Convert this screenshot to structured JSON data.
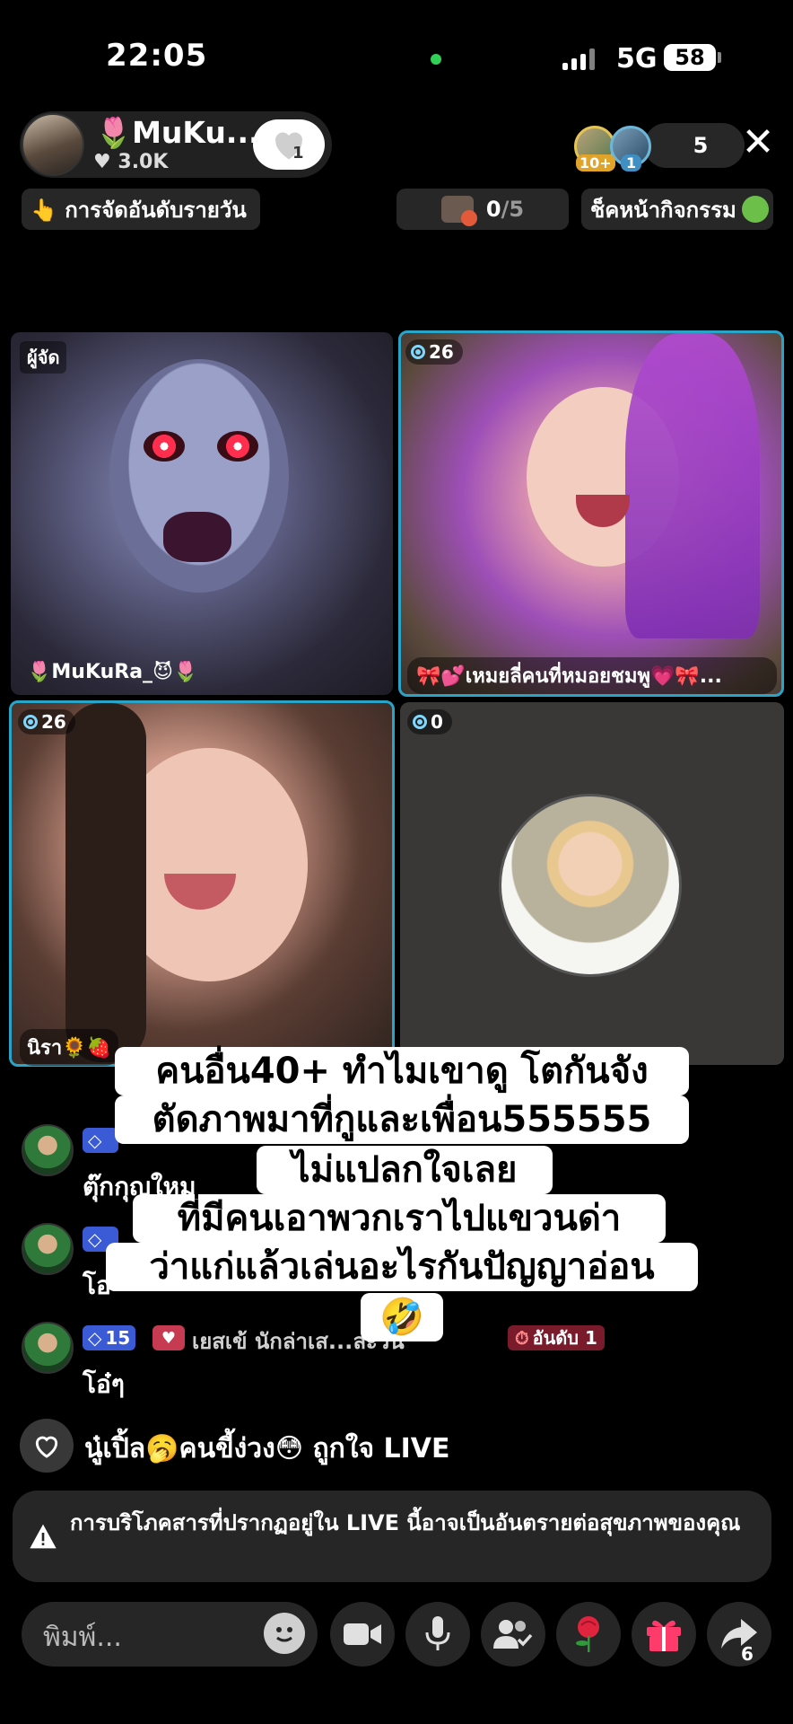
{
  "status_bar": {
    "time": "22:05",
    "network": "5G",
    "battery": "58"
  },
  "host": {
    "name": "🌷MuKu...",
    "likes": "♥ 3.0K",
    "follow_count": "1"
  },
  "viewers": {
    "badge1": "10+",
    "badge2": "1",
    "count": "5"
  },
  "top_pills": {
    "daily_rank": "👆 การจัดอันดับรายวัน",
    "gift_progress_current": "0",
    "gift_progress_total": "/5",
    "activity_check": "ช็คหน้ากิจกรรม"
  },
  "tiles": [
    {
      "tag": "ผู้จัด",
      "name": "🌷MuKuRa_😈🌷"
    },
    {
      "count": "26",
      "name": "🎀💕เหมยลี่คนที่หมอยชมพู💗🎀..."
    },
    {
      "count": "26",
      "name": "นิรา🌻🍓"
    },
    {
      "count": "0"
    }
  ],
  "comments": [
    {
      "level": "",
      "text": "ตุ๊กกุญใหม"
    },
    {
      "level": "",
      "text": "โอ"
    },
    {
      "level": "15",
      "title": "เยสเข้ นักล่าเส...ละวัน",
      "rank": "อันดับ 1",
      "text": "โอ๋ๆ"
    }
  ],
  "caption_lines": [
    "คนอื่น40+ ทำไมเขาดู โตกันจัง",
    "ตัดภาพมาที่กูและเพื่อน555555",
    "ไม่แปลกใจเลย",
    "ที่มีคนเอาพวกเราไปแขวนด่า",
    "ว่าแก่แล้วเล่นอะไรกันปัญญาอ่อน",
    "🤣"
  ],
  "like_bar": {
    "text": "นู๋เปิ้ล🥱คนขี้ง่วง😳 ถูกใจ LIVE"
  },
  "warning": {
    "text": "การบริโภคสารที่ปรากฏอยู่ใน LIVE นี้อาจเป็นอันตรายต่อสุขภาพของคุณ"
  },
  "bottom_bar": {
    "placeholder": "พิมพ์...",
    "share_count": "6"
  }
}
